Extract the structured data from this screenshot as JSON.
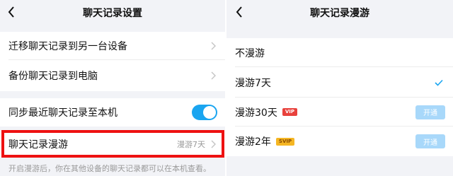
{
  "left": {
    "title": "聊天记录设置",
    "items": [
      {
        "label": "迁移聊天记录到另一台设备"
      },
      {
        "label": "备份聊天记录到电脑"
      },
      {
        "label": "同步最近聊天记录至本机",
        "toggle": true
      },
      {
        "label": "聊天记录漫游",
        "value": "漫游7天"
      }
    ],
    "footnote": "开启漫游后，你在其他设备的聊天记录都可以在本机查看。",
    "colors": {
      "accent": "#1aa5f0",
      "highlight": "#ee1111"
    }
  },
  "right": {
    "title": "聊天记录漫游",
    "options": [
      {
        "label": "不漫游"
      },
      {
        "label": "漫游7天",
        "selected": true
      },
      {
        "label": "漫游30天",
        "badge": "VIP",
        "action": "开通"
      },
      {
        "label": "漫游2年",
        "badge": "SVIP",
        "action": "开通"
      }
    ]
  }
}
